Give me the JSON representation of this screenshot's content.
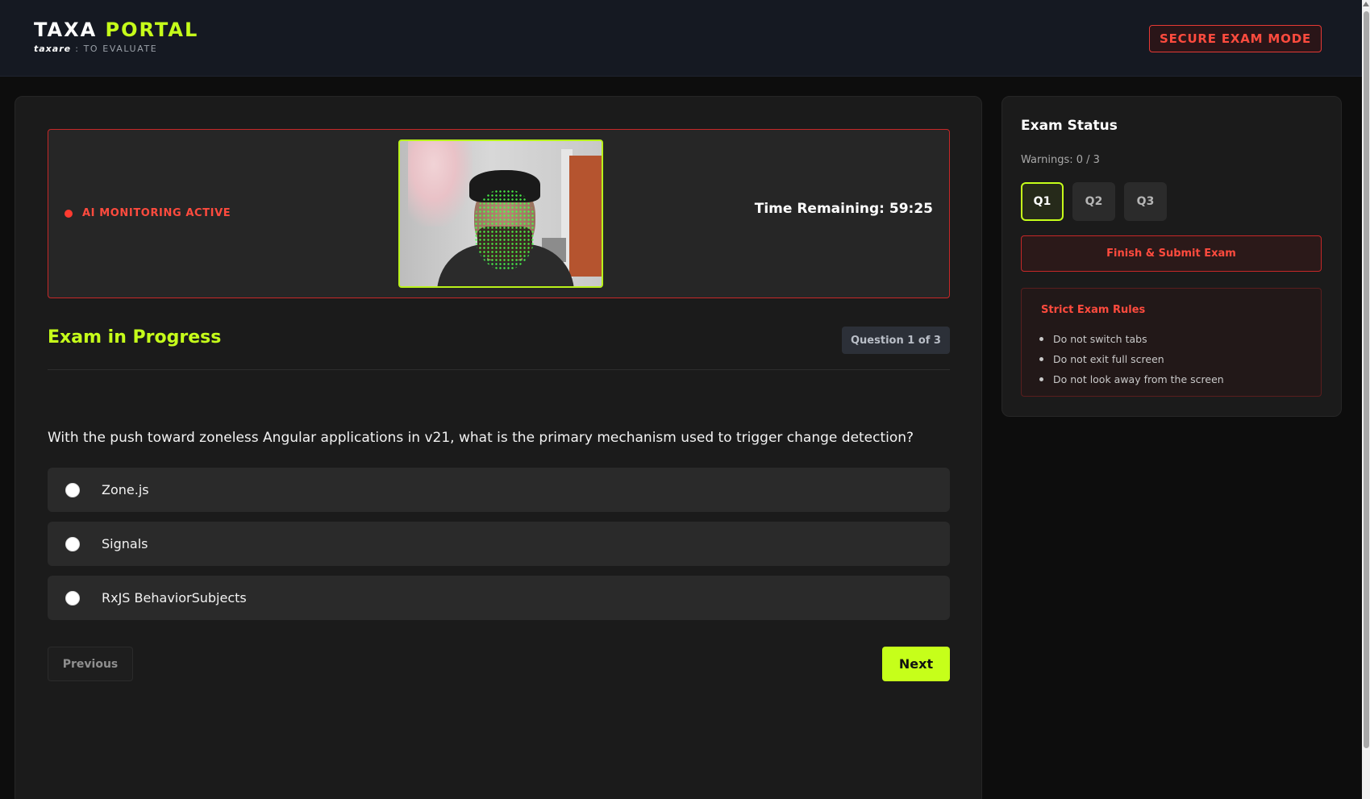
{
  "header": {
    "logo_primary": "TAXA",
    "logo_accent": "PORTAL",
    "tagline_word": "taxare",
    "tagline_rest": " : TO EVALUATE",
    "mode_badge": "SECURE EXAM MODE"
  },
  "monitor": {
    "status_label": "AI MONITORING ACTIVE",
    "timer_label": "Time Remaining: 59:25"
  },
  "exam": {
    "title": "Exam in Progress",
    "counter": "Question 1 of 3",
    "question": "With the push toward zoneless Angular applications in v21, what is the primary mechanism used to trigger change detection?",
    "options": [
      {
        "label": "Zone.js"
      },
      {
        "label": "Signals"
      },
      {
        "label": "RxJS BehaviorSubjects"
      }
    ],
    "prev_label": "Previous",
    "next_label": "Next"
  },
  "sidebar": {
    "title": "Exam Status",
    "warnings": "Warnings: 0 / 3",
    "questions": [
      {
        "label": "Q1",
        "active": true
      },
      {
        "label": "Q2",
        "active": false
      },
      {
        "label": "Q3",
        "active": false
      }
    ],
    "submit_label": "Finish & Submit Exam",
    "rules_title": "Strict Exam Rules",
    "rules": [
      "Do not switch tabs",
      "Do not exit full screen",
      "Do not look away from the screen"
    ]
  },
  "colors": {
    "accent": "#c6ff1a",
    "danger": "#ff4b3e",
    "background": "#0d0d0d",
    "card": "#1b1b1b"
  },
  "icons": {
    "monitor_status": "red-dot-icon",
    "option_selector": "radio-icon"
  }
}
